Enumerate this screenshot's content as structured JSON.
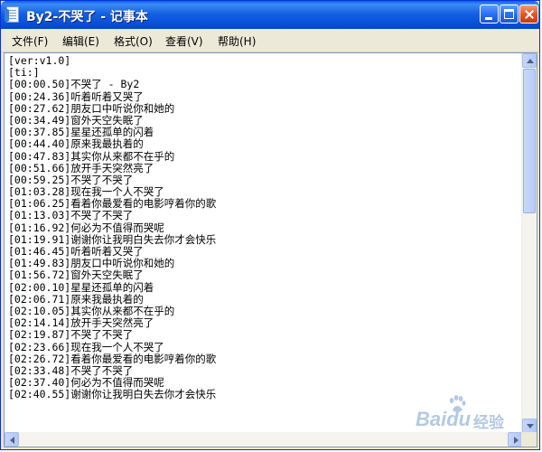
{
  "window": {
    "title": "By2-不哭了 - 记事本",
    "icon": "notepad-icon"
  },
  "title_buttons": {
    "minimize": "minimize-icon",
    "maximize": "maximize-icon",
    "close": "close-icon"
  },
  "menu": [
    {
      "label": "文件(F)"
    },
    {
      "label": "编辑(E)"
    },
    {
      "label": "格式(O)"
    },
    {
      "label": "查看(V)"
    },
    {
      "label": "帮助(H)"
    }
  ],
  "lines": [
    "[ver:v1.0]",
    "[ti:]",
    "[00:00.50]不哭了 - By2",
    "[00:24.36]听着听着又哭了",
    "[00:27.62]朋友口中听说你和她的",
    "[00:34.49]窗外天空失眠了",
    "[00:37.85]星星还孤单的闪着",
    "[00:44.40]原来我最执着的",
    "[00:47.83]其实你从来都不在乎的",
    "[00:51.66]放开手天突然亮了",
    "[00:59.25]不哭了不哭了",
    "[01:03.28]现在我一个人不哭了",
    "[01:06.25]看着你最爱看的电影哼着你的歌",
    "[01:13.03]不哭了不哭了",
    "[01:16.92]何必为不值得而哭呢",
    "[01:19.91]谢谢你让我明白失去你才会快乐",
    "[01:46.45]听着听着又哭了",
    "[01:49.83]朋友口中听说你和她的",
    "[01:56.72]窗外天空失眠了",
    "[02:00.10]星星还孤单的闪着",
    "[02:06.71]原来我最执着的",
    "[02:10.05]其实你从来都不在乎的",
    "[02:14.14]放开手天突然亮了",
    "[02:19.87]不哭了不哭了",
    "[02:23.66]现在我一个人不哭了",
    "[02:26.72]看着你最爱看的电影哼着你的歌",
    "[02:33.48]不哭了不哭了",
    "[02:37.40]何必为不值得而哭呢",
    "[02:40.55]谢谢你让我明白失去你才会快乐"
  ],
  "watermark": {
    "brand": "Baidu",
    "sub": "经验"
  },
  "colors": {
    "title_bar": "#0a5fe8",
    "close_button": "#e0541f",
    "menu_bg": "#ece9d8"
  }
}
